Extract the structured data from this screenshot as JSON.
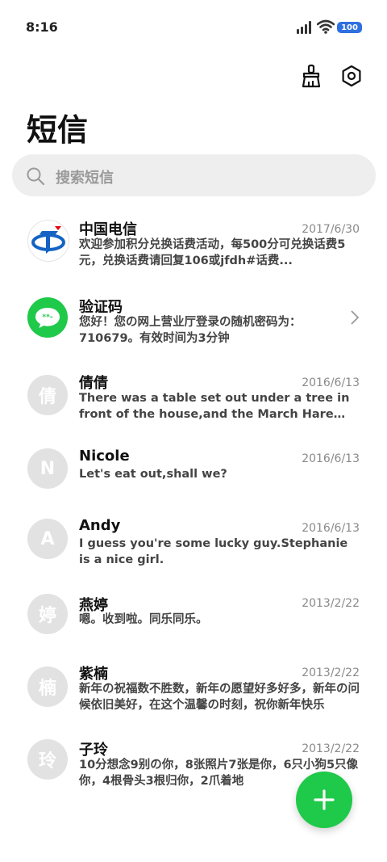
{
  "status_bar": {
    "time": "8:16",
    "battery": "100"
  },
  "page": {
    "title": "短信"
  },
  "search": {
    "placeholder": "搜索短信"
  },
  "conversations": [
    {
      "sender": "中国电信",
      "date": "2017/6/30",
      "preview": "欢迎参加积分兑换话费活动，每500分可兑换话费5元，兑换话费请回复106或jfdh#话费...",
      "avatar": "china-telecom-logo"
    },
    {
      "sender": "验证码",
      "date": "",
      "preview": "您好！您の网上营业厅登录の随机密码为：710679。有效时间为3分钟",
      "avatar": "message-bubble"
    },
    {
      "sender": "倩倩",
      "date": "2016/6/13",
      "preview": "There was a table set out under a tree in front of the house,and the March Hare and the Hatter were having tea at it",
      "avatar_letter": "倩"
    },
    {
      "sender": "Nicole",
      "date": "2016/6/13",
      "preview": "Let's eat out,shall we?",
      "avatar_letter": "N"
    },
    {
      "sender": "Andy",
      "date": "2016/6/13",
      "preview": "I guess you're some lucky guy.Stephanie is a nice girl.",
      "avatar_letter": "A"
    },
    {
      "sender": "燕婷",
      "date": "2013/2/22",
      "preview": "嗯。收到啦。同乐同乐。",
      "avatar_letter": "婷"
    },
    {
      "sender": "紫楠",
      "date": "2013/2/22",
      "preview": "新年の祝福数不胜数，新年の愿望好多好多，新年の问候依旧美好，在这个温馨の时刻，祝你新年快乐",
      "avatar_letter": "楠"
    },
    {
      "sender": "子玲",
      "date": "2013/2/22",
      "preview": "10分想念9别の你，8张照片7张是你，6只小狗5只像你，4根骨头3根归你，2爪着地",
      "avatar_letter": "玲"
    }
  ],
  "colors": {
    "accent": "#1fc94a",
    "telecom_blue": "#1463c4",
    "avatar_grey": "#e2e2e2"
  }
}
